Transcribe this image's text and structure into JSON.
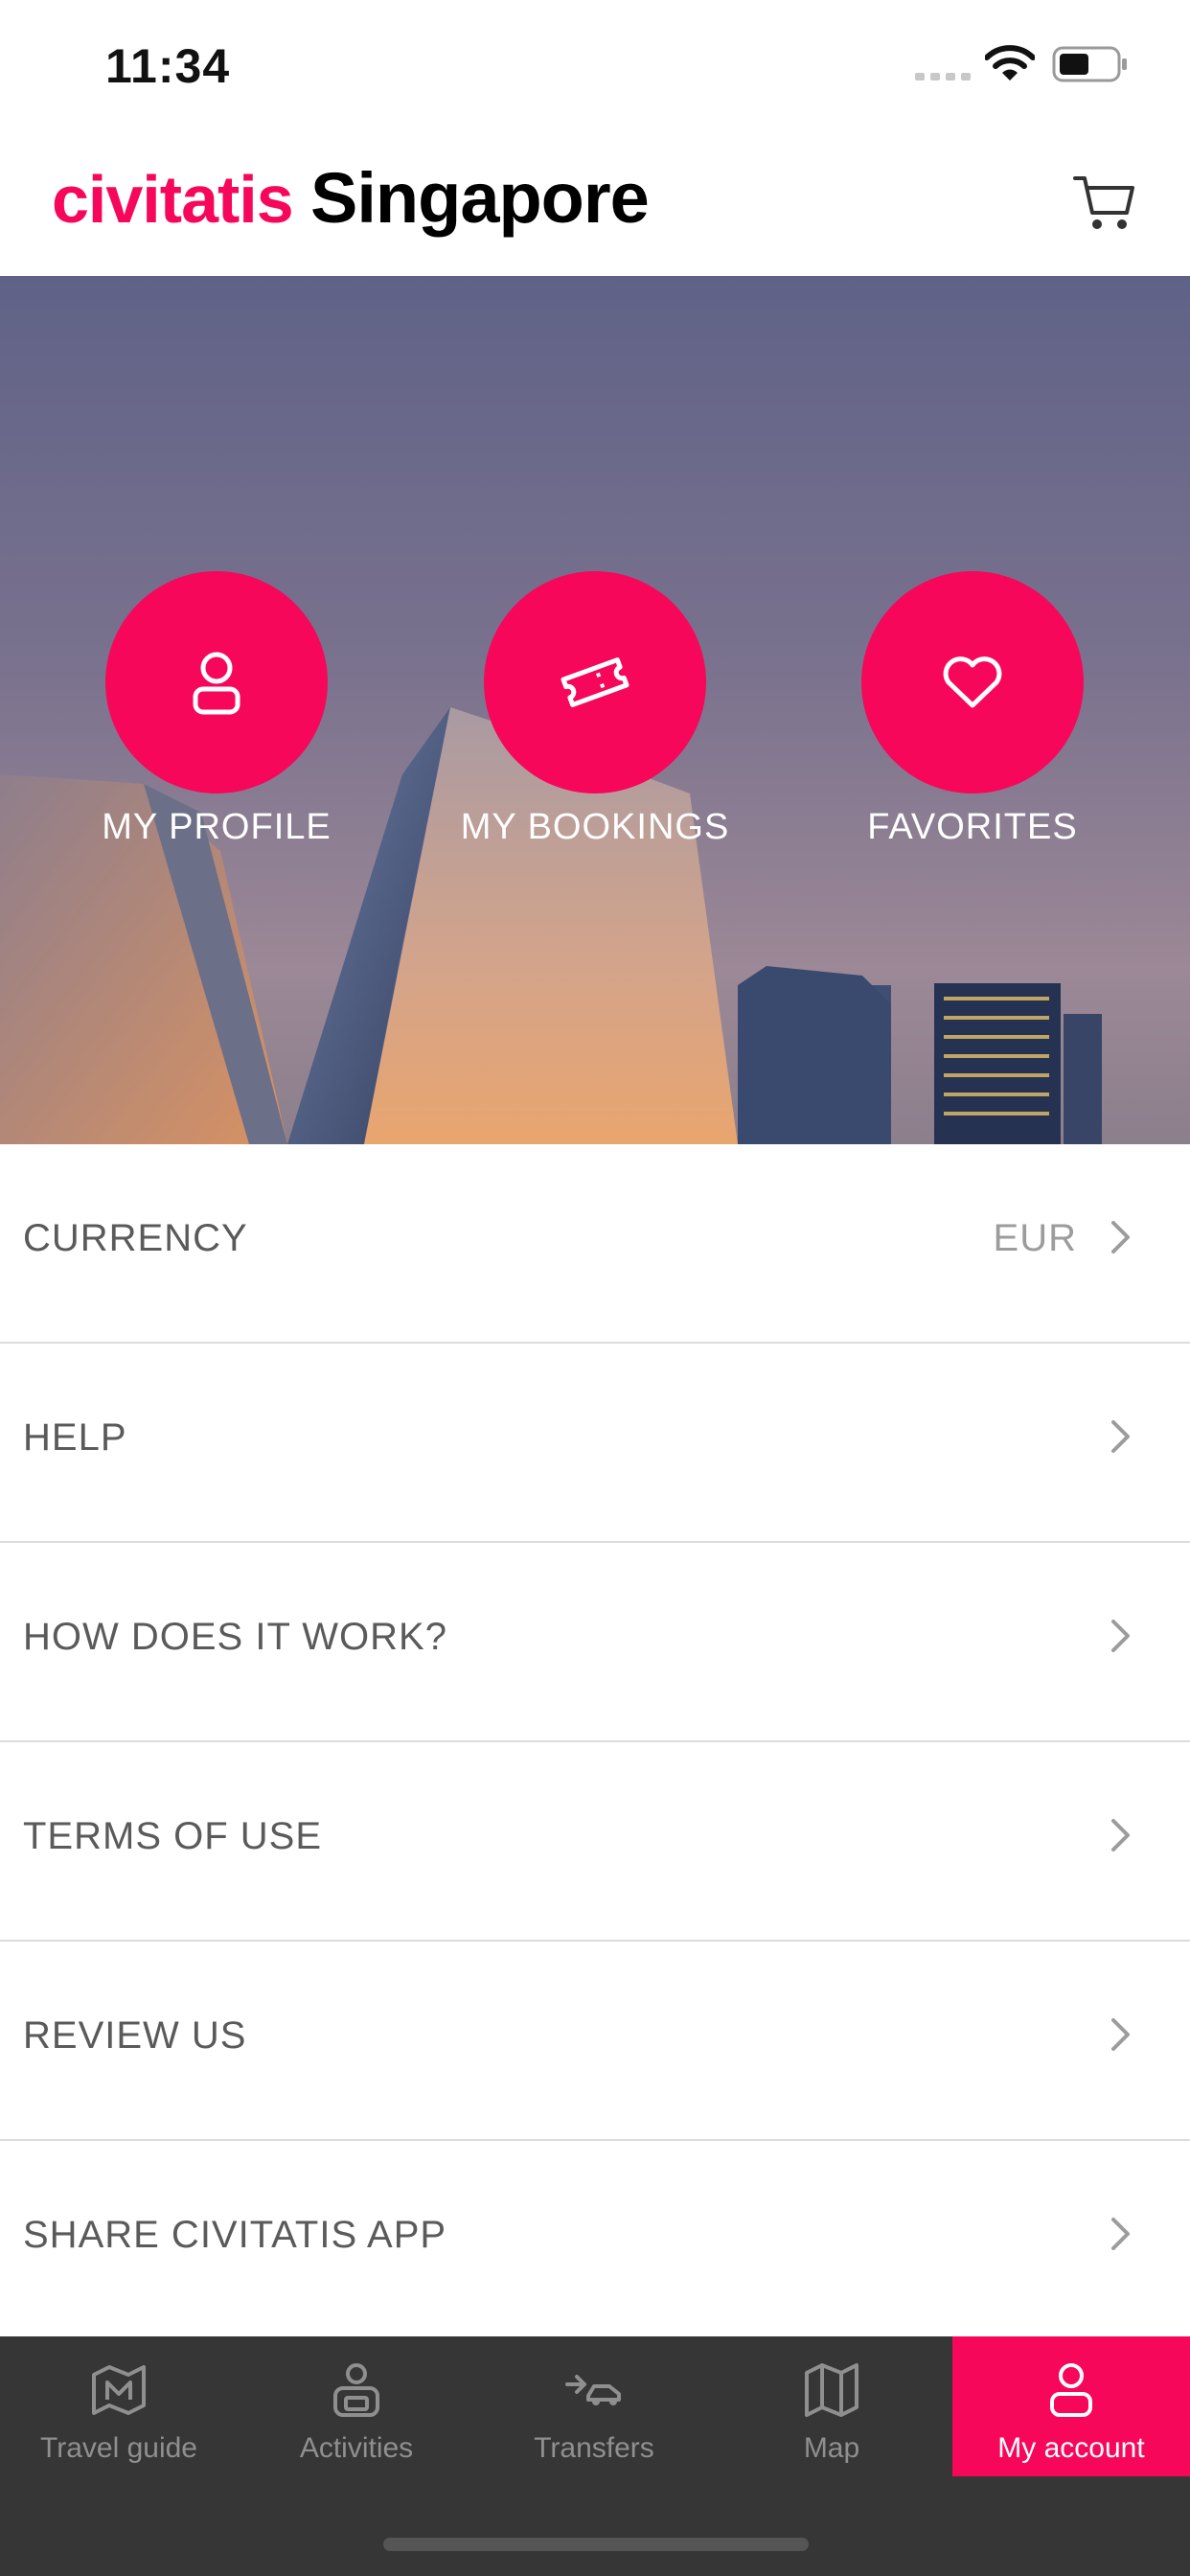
{
  "status_bar": {
    "time": "11:34"
  },
  "header": {
    "brand": "civitatis",
    "city": "Singapore"
  },
  "shortcuts": [
    {
      "label": "MY PROFILE",
      "icon": "user-icon"
    },
    {
      "label": "MY BOOKINGS",
      "icon": "ticket-icon"
    },
    {
      "label": "FAVORITES",
      "icon": "heart-icon"
    }
  ],
  "menu": [
    {
      "label": "CURRENCY",
      "value": "EUR"
    },
    {
      "label": "HELP"
    },
    {
      "label": "HOW DOES IT WORK?"
    },
    {
      "label": "TERMS OF USE"
    },
    {
      "label": "REVIEW US"
    },
    {
      "label": "SHARE CIVITATIS APP"
    }
  ],
  "tabs": [
    {
      "label": "Travel guide",
      "icon": "map-guide-icon"
    },
    {
      "label": "Activities",
      "icon": "activities-icon"
    },
    {
      "label": "Transfers",
      "icon": "transfers-icon"
    },
    {
      "label": "Map",
      "icon": "map-icon"
    },
    {
      "label": "My account",
      "icon": "account-icon",
      "active": true
    }
  ],
  "colors": {
    "accent": "#f70759",
    "tab_bar": "#363636",
    "text": "#5a5a5a"
  }
}
